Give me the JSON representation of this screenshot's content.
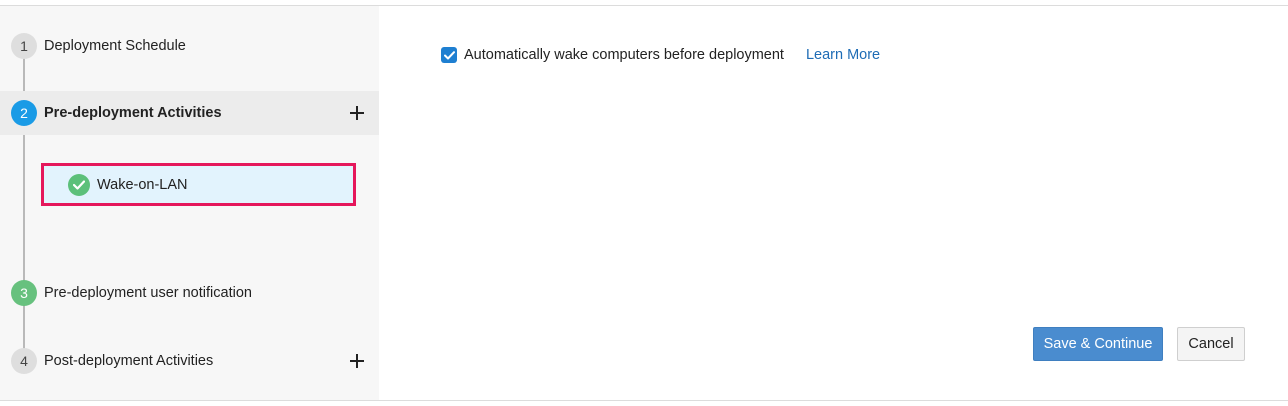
{
  "steps": [
    {
      "number": "1",
      "label": "Deployment Schedule",
      "state": "default",
      "expandable": false
    },
    {
      "number": "2",
      "label": "Pre-deployment Activities",
      "state": "active",
      "expandable": true
    },
    {
      "number": "3",
      "label": "Pre-deployment user notification",
      "state": "completed",
      "expandable": false
    },
    {
      "number": "4",
      "label": "Post-deployment Activities",
      "state": "default",
      "expandable": true
    }
  ],
  "substeps": [
    {
      "label": "Wake-on-LAN",
      "status": "completed",
      "highlighted": true
    }
  ],
  "main": {
    "option": {
      "label": "Automatically wake computers before deployment",
      "checked": true
    },
    "learn_more": "Learn More",
    "save_label": "Save & Continue",
    "cancel_label": "Cancel"
  },
  "colors": {
    "active_step": "#1a9be6",
    "completed": "#67c17e",
    "highlight_border": "#e5175b",
    "primary_button": "#4a8ccf",
    "link": "#1e6cb5"
  },
  "icons": {
    "add": "plus-icon",
    "done": "check-circle-icon",
    "checkbox": "checkmark-icon"
  }
}
